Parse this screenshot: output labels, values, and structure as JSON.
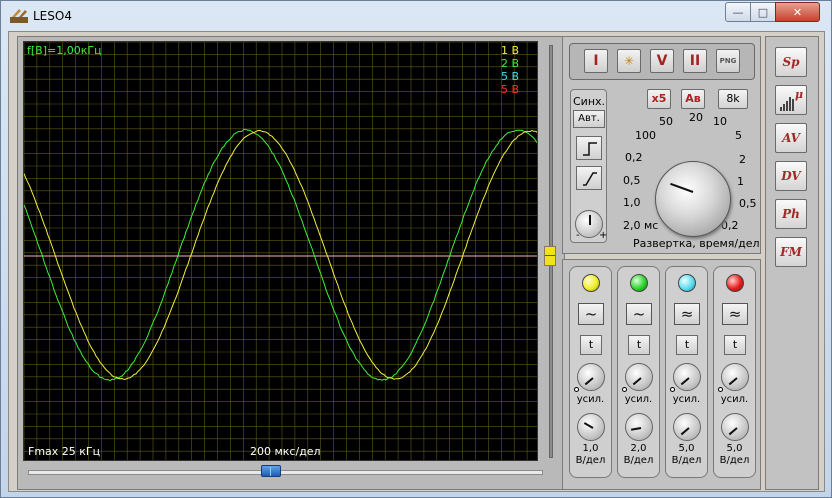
{
  "window": {
    "title": "LESO4",
    "minimize": "—",
    "maximize": "□",
    "close": "✕"
  },
  "scope": {
    "freq_label": "f[B]=1,00кГц",
    "channels_legend": [
      {
        "label": "1 В",
        "color": "#f0f03c"
      },
      {
        "label": "2 В",
        "color": "#3ef03e"
      },
      {
        "label": "5 В",
        "color": "#40e0f0"
      },
      {
        "label": "5 В",
        "color": "#ff3030"
      }
    ],
    "fmax": "Fmax 25 кГц",
    "time_div": "200 мкс/дел",
    "trace_colors": {
      "ch1": "#f0f03c",
      "ch2": "#3ef03e",
      "ref_line": "#ffb0b0",
      "grid": "#5c5c14"
    }
  },
  "toolbar": {
    "buttons": [
      {
        "name": "run-button",
        "icon": "I"
      },
      {
        "name": "cursor-button",
        "icon": "✳"
      },
      {
        "name": "voltage-button",
        "icon": "V"
      },
      {
        "name": "pause-button",
        "icon": "II"
      },
      {
        "name": "save-png-button",
        "icon": "PNG"
      }
    ]
  },
  "sync": {
    "label": "Синх.",
    "auto": "Авт.",
    "minus": "-",
    "plus": "+"
  },
  "timebase": {
    "x5": "x5",
    "av": "Ав",
    "samples": "8k",
    "ticks": [
      "50",
      "20",
      "10",
      "100",
      "5",
      "0,2",
      "2",
      "0,5",
      "1",
      "1,0",
      "0,5",
      "2,0 мс",
      "0,2"
    ],
    "caption": "Развертка, время/дел"
  },
  "channels": [
    {
      "led": "#f0f02a",
      "coupling": "~",
      "t": "t",
      "gain": "усил.",
      "vdiv": "1,0",
      "unit": "В/дел"
    },
    {
      "led": "#2ed42e",
      "coupling": "~",
      "t": "t",
      "gain": "усил.",
      "vdiv": "2,0",
      "unit": "В/дел"
    },
    {
      "led": "#5fdcf0",
      "coupling": "≈",
      "t": "t",
      "gain": "усил.",
      "vdiv": "5,0",
      "unit": "В/дел"
    },
    {
      "led": "#e81e1e",
      "coupling": "≈",
      "t": "t",
      "gain": "усил.",
      "vdiv": "5,0",
      "unit": "В/дел"
    }
  ],
  "right_panel": {
    "buttons": [
      {
        "name": "spectrum-button",
        "label": "Sp"
      },
      {
        "name": "histogram-button",
        "label": "μ"
      },
      {
        "name": "av-meter-button",
        "label": "AV"
      },
      {
        "name": "dv-meter-button",
        "label": "DV"
      },
      {
        "name": "phase-button",
        "label": "Ph"
      },
      {
        "name": "fm-button",
        "label": "FM"
      }
    ]
  }
}
